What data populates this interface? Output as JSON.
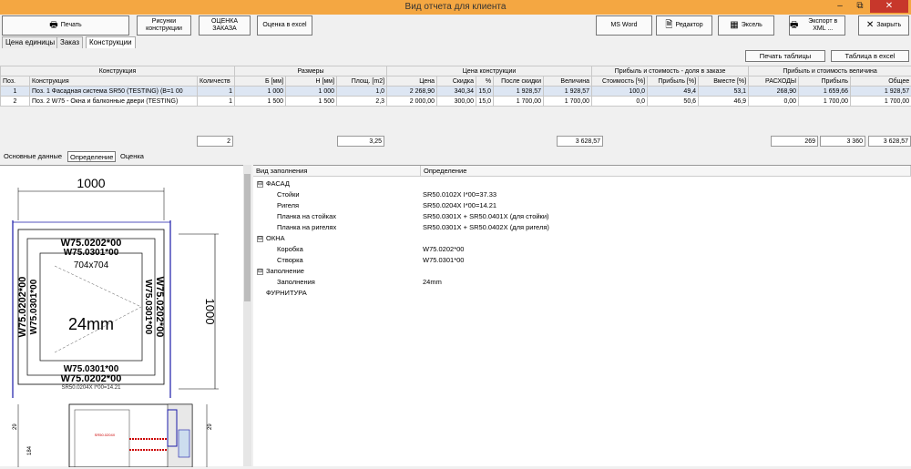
{
  "window": {
    "title": "Вид отчета для клиента",
    "minimize": "–",
    "maximize": "⧉",
    "close": "✕"
  },
  "toolbar": {
    "print": "Печать",
    "drawings": "Рисунки конструкции",
    "estimate": "ОЦЕНКА ЗАКАЗА",
    "estimate_excel": "Оценка в excel",
    "ms_word": "MS Word",
    "editor": "Редактор",
    "excel": "Эксель",
    "export_xml": "Экспорт в XML ...",
    "close": "Закрыть"
  },
  "top_tabs": [
    "Цена единицы",
    "Заказ",
    "Конструкции"
  ],
  "right_buttons": {
    "print_table": "Печать таблицы",
    "table_excel": "Таблица в excel"
  },
  "grid": {
    "groups": [
      "Конструкция",
      "Размеры",
      "Цена конструкции",
      "Прибыль и стоимость - доля в заказе",
      "Прибыль и стоимость величина"
    ],
    "columns": [
      "Поз.",
      "Конструкция",
      "Количеств",
      "Б [мм]",
      "Н [мм]",
      "Площ. [m2]",
      "Цена",
      "Скидка",
      "%",
      "После скидки",
      "Величина",
      "Стоимость [%]",
      "Прибыль [%]",
      "Вместе [%]",
      "РАСХОДЫ",
      "Прибыль",
      "Общее"
    ],
    "rows": [
      [
        "1",
        "Поз.  1 Фасадная система SR50 (TESTING) (B=1 00",
        "1",
        "1 000",
        "1 000",
        "1,0",
        "2 268,90",
        "340,34",
        "15,0",
        "1 928,57",
        "1 928,57",
        "100,0",
        "49,4",
        "53,1",
        "268,90",
        "1 659,66",
        "1 928,57"
      ],
      [
        "2",
        "Поз.  2 W75 - Окна и балконные двери (TESTING)",
        "1",
        "1 500",
        "1 500",
        "2,3",
        "2 000,00",
        "300,00",
        "15,0",
        "1 700,00",
        "1 700,00",
        "0,0",
        "50,6",
        "46,9",
        "0,00",
        "1 700,00",
        "1 700,00"
      ]
    ],
    "totals": {
      "quantity": "2",
      "area": "3,25",
      "amount": "3 628,57",
      "expenses": "269",
      "profit": "3 360",
      "total": "3 628,57"
    }
  },
  "bottom_tabs": [
    "Основные данные",
    "Определение",
    "Оценка"
  ],
  "drawing": {
    "width_top": "1000",
    "height_right": "1000",
    "profile_outer_top": "W75.0202*00",
    "profile_inner_top": "W75.0301*00",
    "opening": "704x704",
    "glass": "24mm",
    "profile_inner_bottom": "W75.0301*00",
    "profile_outer_bottom": "W75.0202*00",
    "left_outer": "W75.0202*00",
    "left_inner": "W75.0301*00",
    "right_inner": "W75.0301*00",
    "right_outer": "W75.0202*00",
    "bottom_partial": "SR50.0204X I*00=14.21",
    "dim_29": "29",
    "dim_184": "184",
    "label_sr": "SR50.0204X"
  },
  "definition": {
    "col_type": "Вид заполнения",
    "col_def": "Определение",
    "tree": [
      {
        "label": "ФАСАД",
        "value": "",
        "level": 0,
        "expander": "⊟"
      },
      {
        "label": "Стойки",
        "value": "SR50.0102X I*00=37.33",
        "level": 1
      },
      {
        "label": "Ригеля",
        "value": "SR50.0204X I*00=14.21",
        "level": 1
      },
      {
        "label": "Планка на стойках",
        "value": "SR50.0301X + SR50.0401X (для стойки)",
        "level": 1
      },
      {
        "label": "Планка на ригелях",
        "value": "SR50.0301X + SR50.0402X (для ригеля)",
        "level": 1
      },
      {
        "label": "ОКНА",
        "value": "",
        "level": 0,
        "expander": "⊟"
      },
      {
        "label": "Коробка",
        "value": "W75.0202*00",
        "level": 1
      },
      {
        "label": "Створка",
        "value": "W75.0301*00",
        "level": 1
      },
      {
        "label": "Заполнение",
        "value": "",
        "level": 0,
        "expander": "⊟"
      },
      {
        "label": "Заполнения",
        "value": "24mm",
        "level": 1
      },
      {
        "label": "ФУРНИТУРА",
        "value": "",
        "level": 0
      }
    ]
  }
}
